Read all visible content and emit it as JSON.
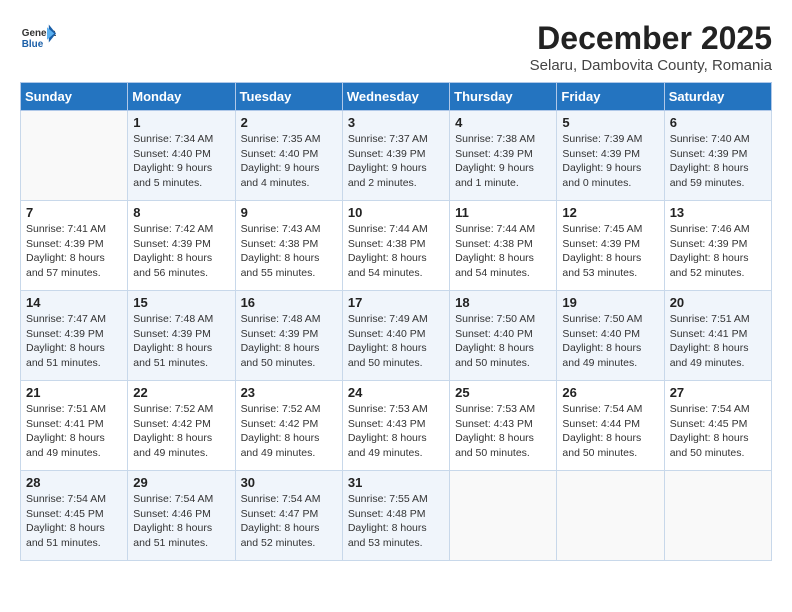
{
  "header": {
    "logo_general": "General",
    "logo_blue": "Blue",
    "month_year": "December 2025",
    "location": "Selaru, Dambovita County, Romania"
  },
  "weekdays": [
    "Sunday",
    "Monday",
    "Tuesday",
    "Wednesday",
    "Thursday",
    "Friday",
    "Saturday"
  ],
  "weeks": [
    [
      {
        "day": "",
        "content": ""
      },
      {
        "day": "1",
        "content": "Sunrise: 7:34 AM\nSunset: 4:40 PM\nDaylight: 9 hours\nand 5 minutes."
      },
      {
        "day": "2",
        "content": "Sunrise: 7:35 AM\nSunset: 4:40 PM\nDaylight: 9 hours\nand 4 minutes."
      },
      {
        "day": "3",
        "content": "Sunrise: 7:37 AM\nSunset: 4:39 PM\nDaylight: 9 hours\nand 2 minutes."
      },
      {
        "day": "4",
        "content": "Sunrise: 7:38 AM\nSunset: 4:39 PM\nDaylight: 9 hours\nand 1 minute."
      },
      {
        "day": "5",
        "content": "Sunrise: 7:39 AM\nSunset: 4:39 PM\nDaylight: 9 hours\nand 0 minutes."
      },
      {
        "day": "6",
        "content": "Sunrise: 7:40 AM\nSunset: 4:39 PM\nDaylight: 8 hours\nand 59 minutes."
      }
    ],
    [
      {
        "day": "7",
        "content": "Sunrise: 7:41 AM\nSunset: 4:39 PM\nDaylight: 8 hours\nand 57 minutes."
      },
      {
        "day": "8",
        "content": "Sunrise: 7:42 AM\nSunset: 4:39 PM\nDaylight: 8 hours\nand 56 minutes."
      },
      {
        "day": "9",
        "content": "Sunrise: 7:43 AM\nSunset: 4:38 PM\nDaylight: 8 hours\nand 55 minutes."
      },
      {
        "day": "10",
        "content": "Sunrise: 7:44 AM\nSunset: 4:38 PM\nDaylight: 8 hours\nand 54 minutes."
      },
      {
        "day": "11",
        "content": "Sunrise: 7:44 AM\nSunset: 4:38 PM\nDaylight: 8 hours\nand 54 minutes."
      },
      {
        "day": "12",
        "content": "Sunrise: 7:45 AM\nSunset: 4:39 PM\nDaylight: 8 hours\nand 53 minutes."
      },
      {
        "day": "13",
        "content": "Sunrise: 7:46 AM\nSunset: 4:39 PM\nDaylight: 8 hours\nand 52 minutes."
      }
    ],
    [
      {
        "day": "14",
        "content": "Sunrise: 7:47 AM\nSunset: 4:39 PM\nDaylight: 8 hours\nand 51 minutes."
      },
      {
        "day": "15",
        "content": "Sunrise: 7:48 AM\nSunset: 4:39 PM\nDaylight: 8 hours\nand 51 minutes."
      },
      {
        "day": "16",
        "content": "Sunrise: 7:48 AM\nSunset: 4:39 PM\nDaylight: 8 hours\nand 50 minutes."
      },
      {
        "day": "17",
        "content": "Sunrise: 7:49 AM\nSunset: 4:40 PM\nDaylight: 8 hours\nand 50 minutes."
      },
      {
        "day": "18",
        "content": "Sunrise: 7:50 AM\nSunset: 4:40 PM\nDaylight: 8 hours\nand 50 minutes."
      },
      {
        "day": "19",
        "content": "Sunrise: 7:50 AM\nSunset: 4:40 PM\nDaylight: 8 hours\nand 49 minutes."
      },
      {
        "day": "20",
        "content": "Sunrise: 7:51 AM\nSunset: 4:41 PM\nDaylight: 8 hours\nand 49 minutes."
      }
    ],
    [
      {
        "day": "21",
        "content": "Sunrise: 7:51 AM\nSunset: 4:41 PM\nDaylight: 8 hours\nand 49 minutes."
      },
      {
        "day": "22",
        "content": "Sunrise: 7:52 AM\nSunset: 4:42 PM\nDaylight: 8 hours\nand 49 minutes."
      },
      {
        "day": "23",
        "content": "Sunrise: 7:52 AM\nSunset: 4:42 PM\nDaylight: 8 hours\nand 49 minutes."
      },
      {
        "day": "24",
        "content": "Sunrise: 7:53 AM\nSunset: 4:43 PM\nDaylight: 8 hours\nand 49 minutes."
      },
      {
        "day": "25",
        "content": "Sunrise: 7:53 AM\nSunset: 4:43 PM\nDaylight: 8 hours\nand 50 minutes."
      },
      {
        "day": "26",
        "content": "Sunrise: 7:54 AM\nSunset: 4:44 PM\nDaylight: 8 hours\nand 50 minutes."
      },
      {
        "day": "27",
        "content": "Sunrise: 7:54 AM\nSunset: 4:45 PM\nDaylight: 8 hours\nand 50 minutes."
      }
    ],
    [
      {
        "day": "28",
        "content": "Sunrise: 7:54 AM\nSunset: 4:45 PM\nDaylight: 8 hours\nand 51 minutes."
      },
      {
        "day": "29",
        "content": "Sunrise: 7:54 AM\nSunset: 4:46 PM\nDaylight: 8 hours\nand 51 minutes."
      },
      {
        "day": "30",
        "content": "Sunrise: 7:54 AM\nSunset: 4:47 PM\nDaylight: 8 hours\nand 52 minutes."
      },
      {
        "day": "31",
        "content": "Sunrise: 7:55 AM\nSunset: 4:48 PM\nDaylight: 8 hours\nand 53 minutes."
      },
      {
        "day": "",
        "content": ""
      },
      {
        "day": "",
        "content": ""
      },
      {
        "day": "",
        "content": ""
      }
    ]
  ]
}
